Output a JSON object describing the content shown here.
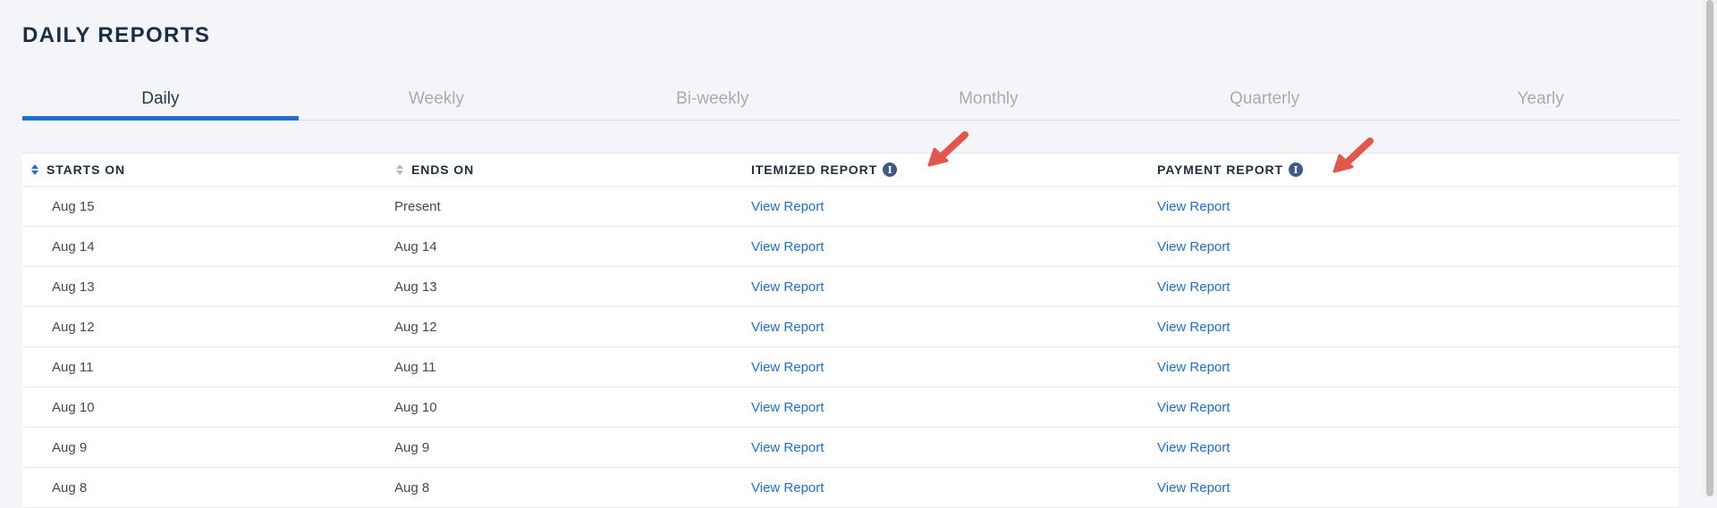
{
  "page": {
    "title": "DAILY REPORTS"
  },
  "tabs": [
    {
      "label": "Daily",
      "active": true
    },
    {
      "label": "Weekly",
      "active": false
    },
    {
      "label": "Bi-weekly",
      "active": false
    },
    {
      "label": "Monthly",
      "active": false
    },
    {
      "label": "Quarterly",
      "active": false
    },
    {
      "label": "Yearly",
      "active": false
    }
  ],
  "table": {
    "headers": {
      "starts_on": "STARTS ON",
      "ends_on": "ENDS ON",
      "itemized_report": "ITEMIZED REPORT",
      "payment_report": "PAYMENT REPORT"
    },
    "rows": [
      {
        "starts_on": "Aug 15",
        "ends_on": "Present",
        "itemized": "View Report",
        "payment": "View Report"
      },
      {
        "starts_on": "Aug 14",
        "ends_on": "Aug 14",
        "itemized": "View Report",
        "payment": "View Report"
      },
      {
        "starts_on": "Aug 13",
        "ends_on": "Aug 13",
        "itemized": "View Report",
        "payment": "View Report"
      },
      {
        "starts_on": "Aug 12",
        "ends_on": "Aug 12",
        "itemized": "View Report",
        "payment": "View Report"
      },
      {
        "starts_on": "Aug 11",
        "ends_on": "Aug 11",
        "itemized": "View Report",
        "payment": "View Report"
      },
      {
        "starts_on": "Aug 10",
        "ends_on": "Aug 10",
        "itemized": "View Report",
        "payment": "View Report"
      },
      {
        "starts_on": "Aug 9",
        "ends_on": "Aug 9",
        "itemized": "View Report",
        "payment": "View Report"
      },
      {
        "starts_on": "Aug 8",
        "ends_on": "Aug 8",
        "itemized": "View Report",
        "payment": "View Report"
      }
    ]
  },
  "icons": {
    "sort": "sort-arrows-icon",
    "info": "info-icon",
    "annotation_arrow": "red-arrow-icon"
  },
  "colors": {
    "accent": "#1f6fcf",
    "title": "#1a2e44",
    "info_badge": "#3e5a86",
    "annotation_arrow": "#e2564b",
    "page_background": "#f4f5f8"
  }
}
